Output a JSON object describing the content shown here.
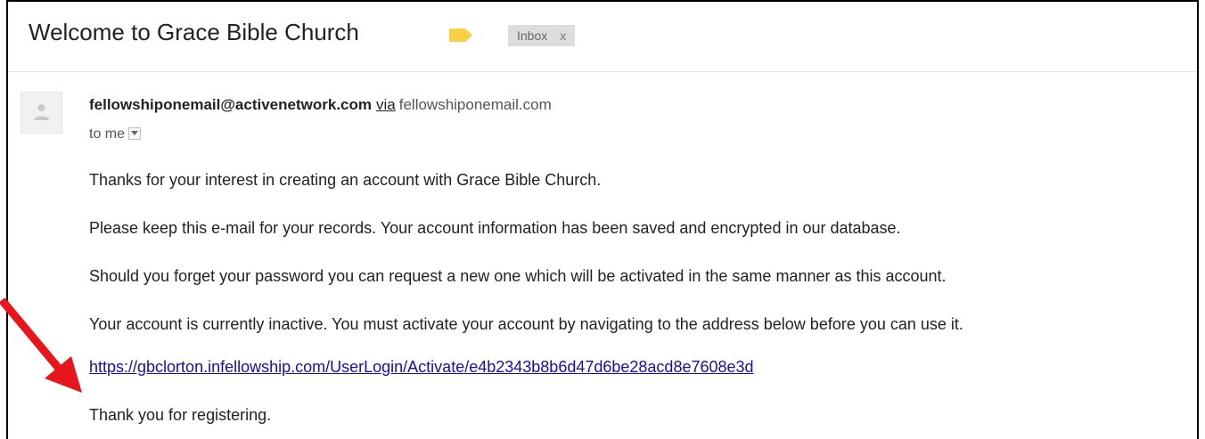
{
  "email": {
    "subject": "Welcome to Grace Bible Church",
    "label_icon": "importance-label-icon",
    "inbox_chip": {
      "label": "Inbox",
      "remove": "x"
    },
    "sender": {
      "email": "fellowshiponemail@activenetwork.com",
      "via": "via",
      "via_domain": "fellowshiponemail.com",
      "avatar_icon": "person-icon"
    },
    "recipient": "to me",
    "body": {
      "line1": "Thanks for your interest in creating an account with Grace Bible Church.",
      "line2": "Please keep this e-mail for your records. Your account information has been saved and encrypted in our database.",
      "line3": "Should you forget your password you can request a new one which will be activated in the same manner as this account.",
      "line4": "Your account is currently inactive. You must activate your account by navigating to the address below before you can use it.",
      "link": "https://gbclorton.infellowship.com/UserLogin/Activate/e4b2343b8b6d47d6be28acd8e7608e3d",
      "closing": "Thank you for registering."
    }
  },
  "annotation": {
    "arrow_color": "#e8151b"
  },
  "colors": {
    "label_yellow": "#f7d046",
    "link": "#1a0dab",
    "chip_bg": "#dddddd"
  }
}
